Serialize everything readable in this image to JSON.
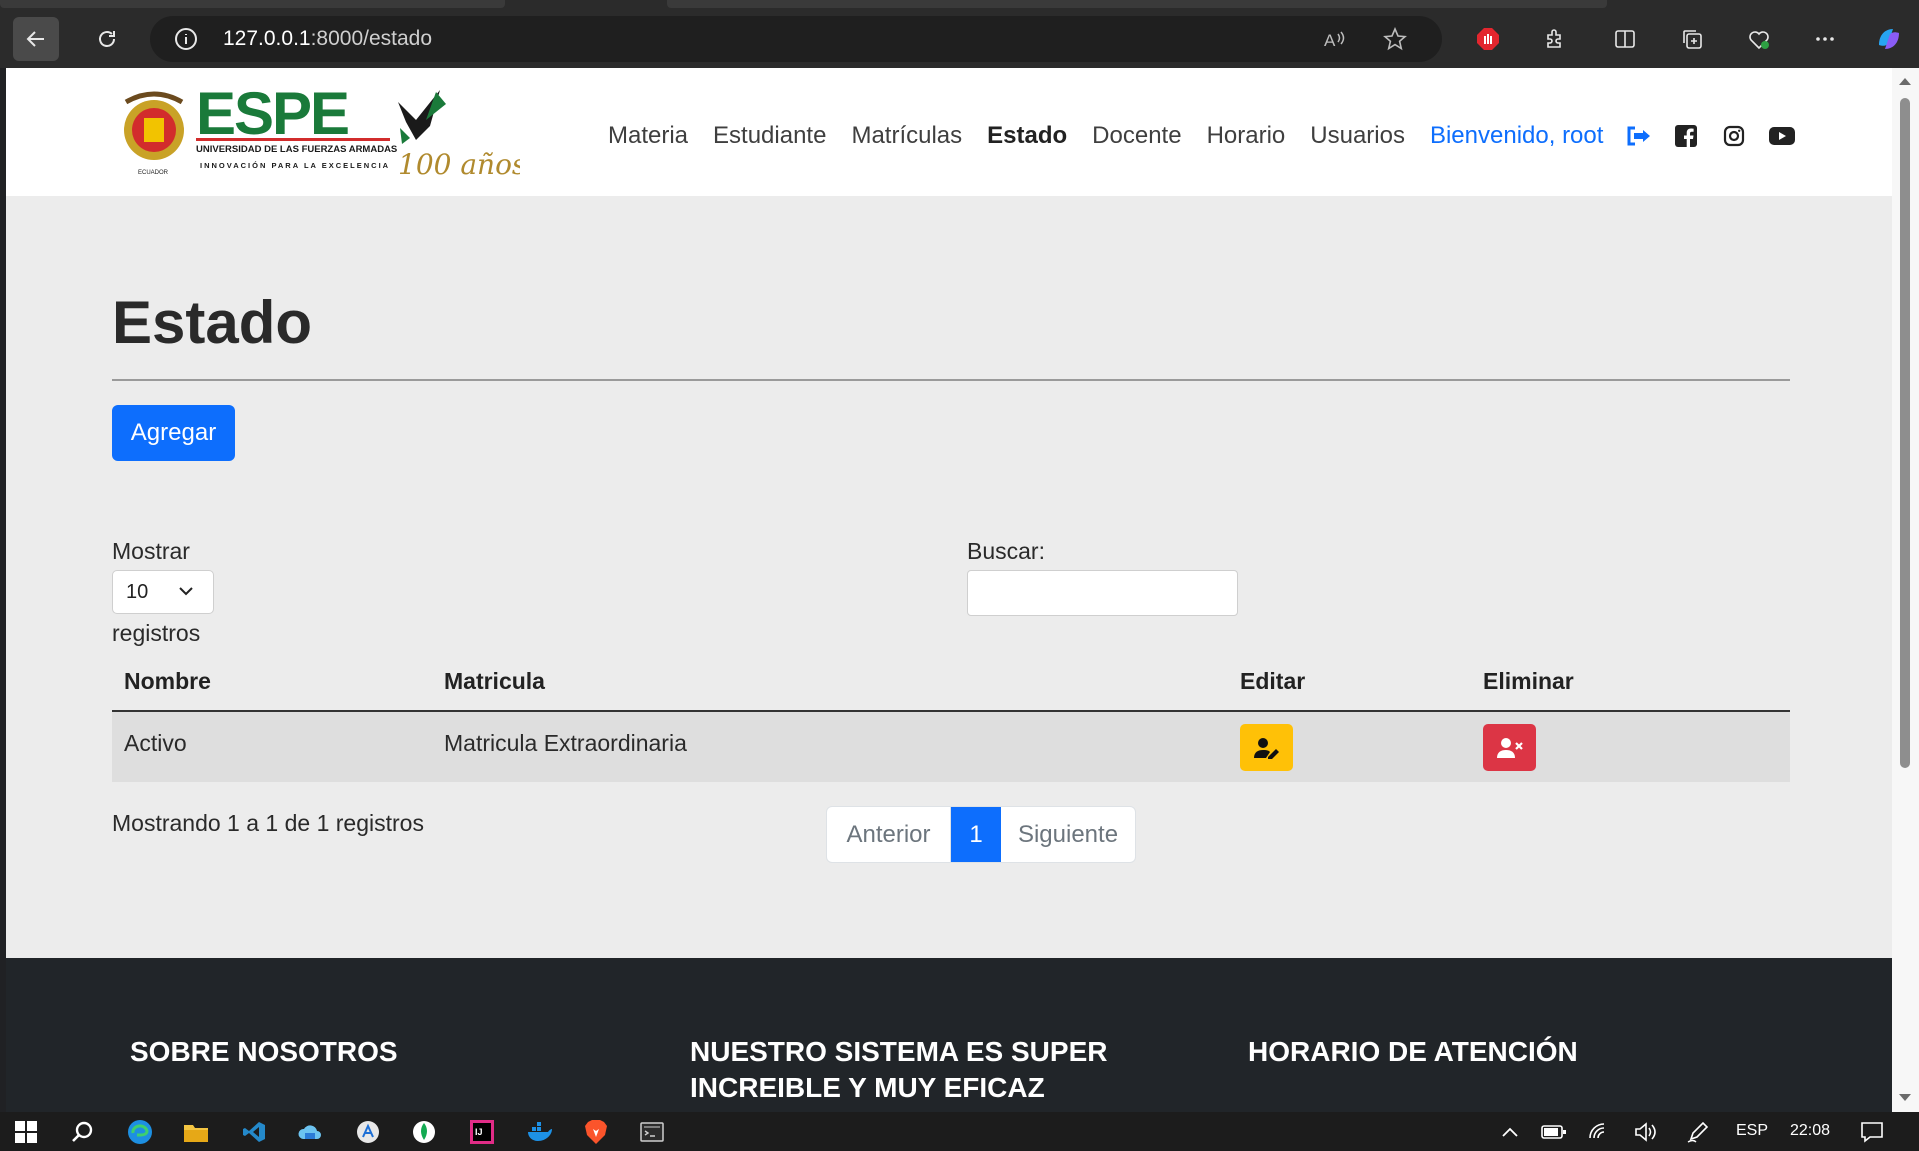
{
  "browser": {
    "url_host": "127.0.0.1",
    "url_path": ":8000/estado"
  },
  "navbar": {
    "logo_text": "ESPE",
    "logo_subtitle": "UNIVERSIDAD DE LAS FUERZAS ARMADAS",
    "logo_tagline": "INNOVACIÓN PARA LA EXCELENCIA",
    "logo_years": "100 años",
    "links": [
      {
        "label": "Materia"
      },
      {
        "label": "Estudiante"
      },
      {
        "label": "Matrículas"
      },
      {
        "label": "Estado"
      },
      {
        "label": "Docente"
      },
      {
        "label": "Horario"
      },
      {
        "label": "Usuarios"
      }
    ],
    "welcome": "Bienvenido, root"
  },
  "page": {
    "title": "Estado",
    "add_button": "Agregar",
    "show_label": "Mostrar",
    "show_value": "10",
    "records_label": "registros",
    "search_label": "Buscar:",
    "search_value": ""
  },
  "table": {
    "headers": [
      "Nombre",
      "Matricula",
      "Editar",
      "Eliminar"
    ],
    "rows": [
      {
        "nombre": "Activo",
        "matricula": "Matricula Extraordinaria"
      }
    ],
    "info": "Mostrando 1 a 1 de 1 registros"
  },
  "pagination": {
    "prev": "Anterior",
    "current": "1",
    "next": "Siguiente"
  },
  "footer": {
    "col1": "SOBRE NOSOTROS",
    "col2_line1": "NUESTRO SISTEMA ES SUPER",
    "col2_line2": "INCREIBLE Y MUY EFICAZ",
    "col3": "HORARIO DE ATENCIÓN"
  },
  "taskbar": {
    "lang": "ESP",
    "time": "22:08"
  },
  "colors": {
    "primary": "#0d6efd",
    "warning": "#ffc107",
    "danger": "#dc3545",
    "footer_bg": "#212529",
    "logo_green": "#1a7a3a"
  }
}
